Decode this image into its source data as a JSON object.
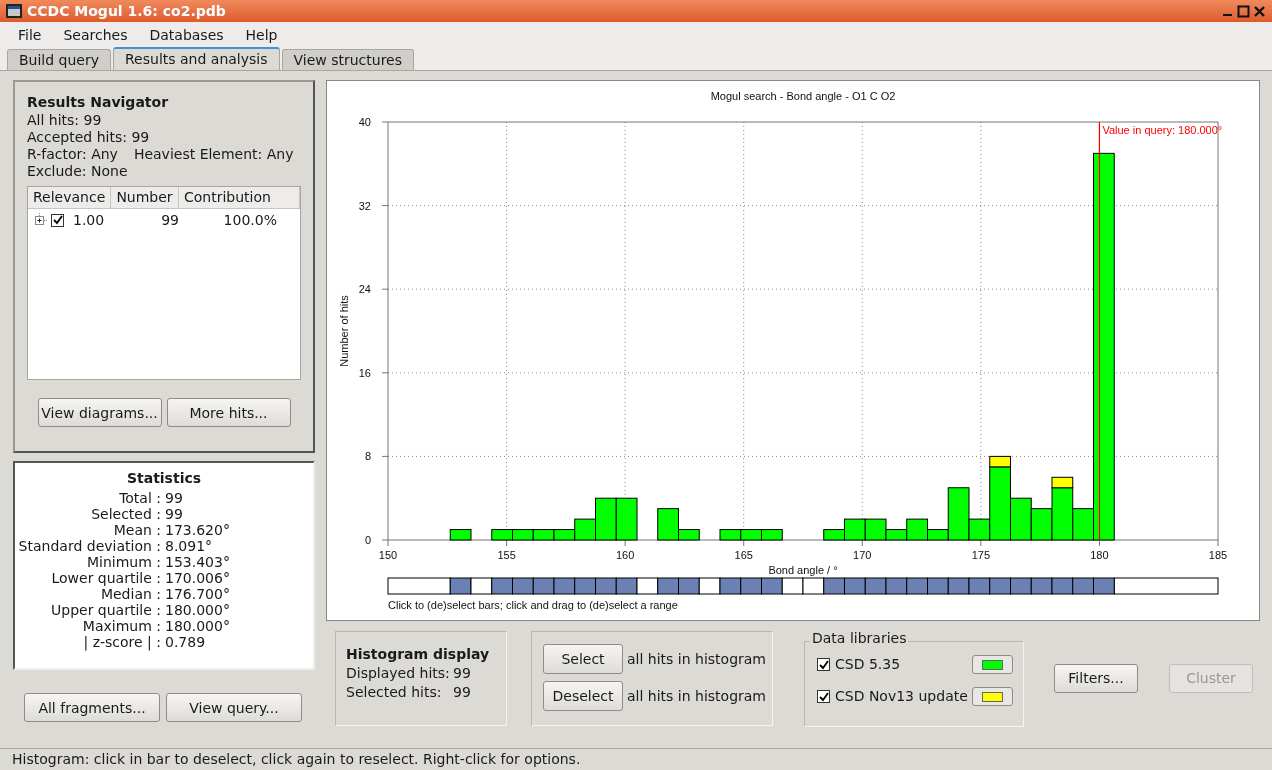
{
  "window": {
    "title": "CCDC Mogul 1.6: co2.pdb"
  },
  "menu": [
    "File",
    "Searches",
    "Databases",
    "Help"
  ],
  "tabs": [
    {
      "label": "Build query",
      "selected": false
    },
    {
      "label": "Results and analysis",
      "selected": true
    },
    {
      "label": "View structures",
      "selected": false
    }
  ],
  "results_navigator": {
    "title": "Results Navigator",
    "lines": [
      "All hits: 99",
      "Accepted hits: 99"
    ],
    "filters": [
      "R-factor: Any",
      "Heaviest Element: Any"
    ],
    "exclude": "Exclude: None",
    "table": {
      "columns": [
        "Relevance",
        "Number",
        "Contribution"
      ],
      "rows": [
        {
          "cells": [
            "1.00",
            "99",
            "100.0%"
          ],
          "checked": true,
          "expanded": false
        }
      ]
    },
    "buttons": [
      "View diagrams...",
      "More hits..."
    ]
  },
  "statistics": {
    "title": "Statistics",
    "rows": [
      {
        "label": "Total :",
        "value": "99"
      },
      {
        "label": "Selected :",
        "value": "99"
      },
      {
        "label": "Mean :",
        "value": "173.620°"
      },
      {
        "label": "Standard deviation :",
        "value": "8.091°"
      },
      {
        "label": "Minimum :",
        "value": "153.403°"
      },
      {
        "label": "Lower quartile :",
        "value": "170.006°"
      },
      {
        "label": "Median :",
        "value": "176.700°"
      },
      {
        "label": "Upper quartile :",
        "value": "180.000°"
      },
      {
        "label": "Maximum :",
        "value": "180.000°"
      },
      {
        "label": "| z-score | :",
        "value": "0.789"
      }
    ]
  },
  "left_buttons": [
    "All fragments...",
    "View query..."
  ],
  "histogram": {
    "chart_data": {
      "type": "bar",
      "title": "Mogul search - Bond angle - O1 C O2",
      "xlabel": "Bond angle / °",
      "ylabel": "Number of hits",
      "stacked": true,
      "x": [
        153.0625,
        153.9375,
        154.8125,
        155.6875,
        156.5625,
        157.4375,
        158.3125,
        159.1875,
        160.0625,
        160.9375,
        161.8125,
        162.6875,
        163.5625,
        164.4375,
        165.3125,
        166.1875,
        167.0625,
        167.9375,
        168.8125,
        169.6875,
        170.5625,
        171.4375,
        172.3125,
        173.1875,
        174.0625,
        174.9375,
        175.8125,
        176.6875,
        177.5625,
        178.4375,
        179.3125,
        180.1875
      ],
      "series": [
        {
          "name": "CSD 5.35",
          "color": "#00ff00",
          "values": [
            1,
            0,
            1,
            1,
            1,
            1,
            2,
            4,
            4,
            0,
            3,
            1,
            0,
            1,
            1,
            1,
            0,
            0,
            1,
            2,
            2,
            1,
            2,
            1,
            5,
            2,
            7,
            4,
            3,
            5,
            3,
            37
          ]
        },
        {
          "name": "CSD Nov13 update",
          "color": "#ffff00",
          "values": [
            0,
            0,
            0,
            0,
            0,
            0,
            0,
            0,
            0,
            0,
            0,
            0,
            0,
            0,
            0,
            0,
            0,
            0,
            0,
            0,
            0,
            0,
            0,
            0,
            0,
            0,
            1,
            0,
            0,
            1,
            0,
            0
          ]
        }
      ],
      "xlim": [
        150,
        185
      ],
      "ylim": [
        0,
        40
      ],
      "xticks": [
        150,
        155,
        160,
        165,
        170,
        175,
        180,
        185
      ],
      "yticks": [
        0,
        8,
        16,
        24,
        32,
        40
      ],
      "grid": true,
      "ref_lines": [
        {
          "axis": "x",
          "value": 180,
          "label": "Value in query: 180.000°"
        }
      ]
    },
    "bin_selected": [
      true,
      false,
      true,
      true,
      true,
      true,
      true,
      true,
      true,
      false,
      true,
      true,
      false,
      true,
      true,
      true,
      false,
      false,
      true,
      true,
      true,
      true,
      true,
      true,
      true,
      true,
      true,
      true,
      true,
      true,
      true,
      true
    ],
    "hint": "Click to (de)select bars; click and drag to (de)select a range"
  },
  "histogram_display": {
    "title": "Histogram display",
    "rows": [
      {
        "label": "Displayed hits:",
        "value": "99"
      },
      {
        "label": "Selected hits:",
        "value": "99"
      }
    ]
  },
  "selection": [
    {
      "button": "Select",
      "text": "all hits in histogram"
    },
    {
      "button": "Deselect",
      "text": "all hits in histogram"
    }
  ],
  "data_libraries": {
    "title": "Data libraries",
    "items": [
      {
        "checked": true
      },
      {
        "checked": true
      }
    ]
  },
  "actions": [
    {
      "label": "Filters...",
      "disabled": false
    },
    {
      "label": "Cluster",
      "disabled": true
    }
  ],
  "status_bar": "Histogram: click in bar to deselect, click again to reselect. Right-click for options."
}
